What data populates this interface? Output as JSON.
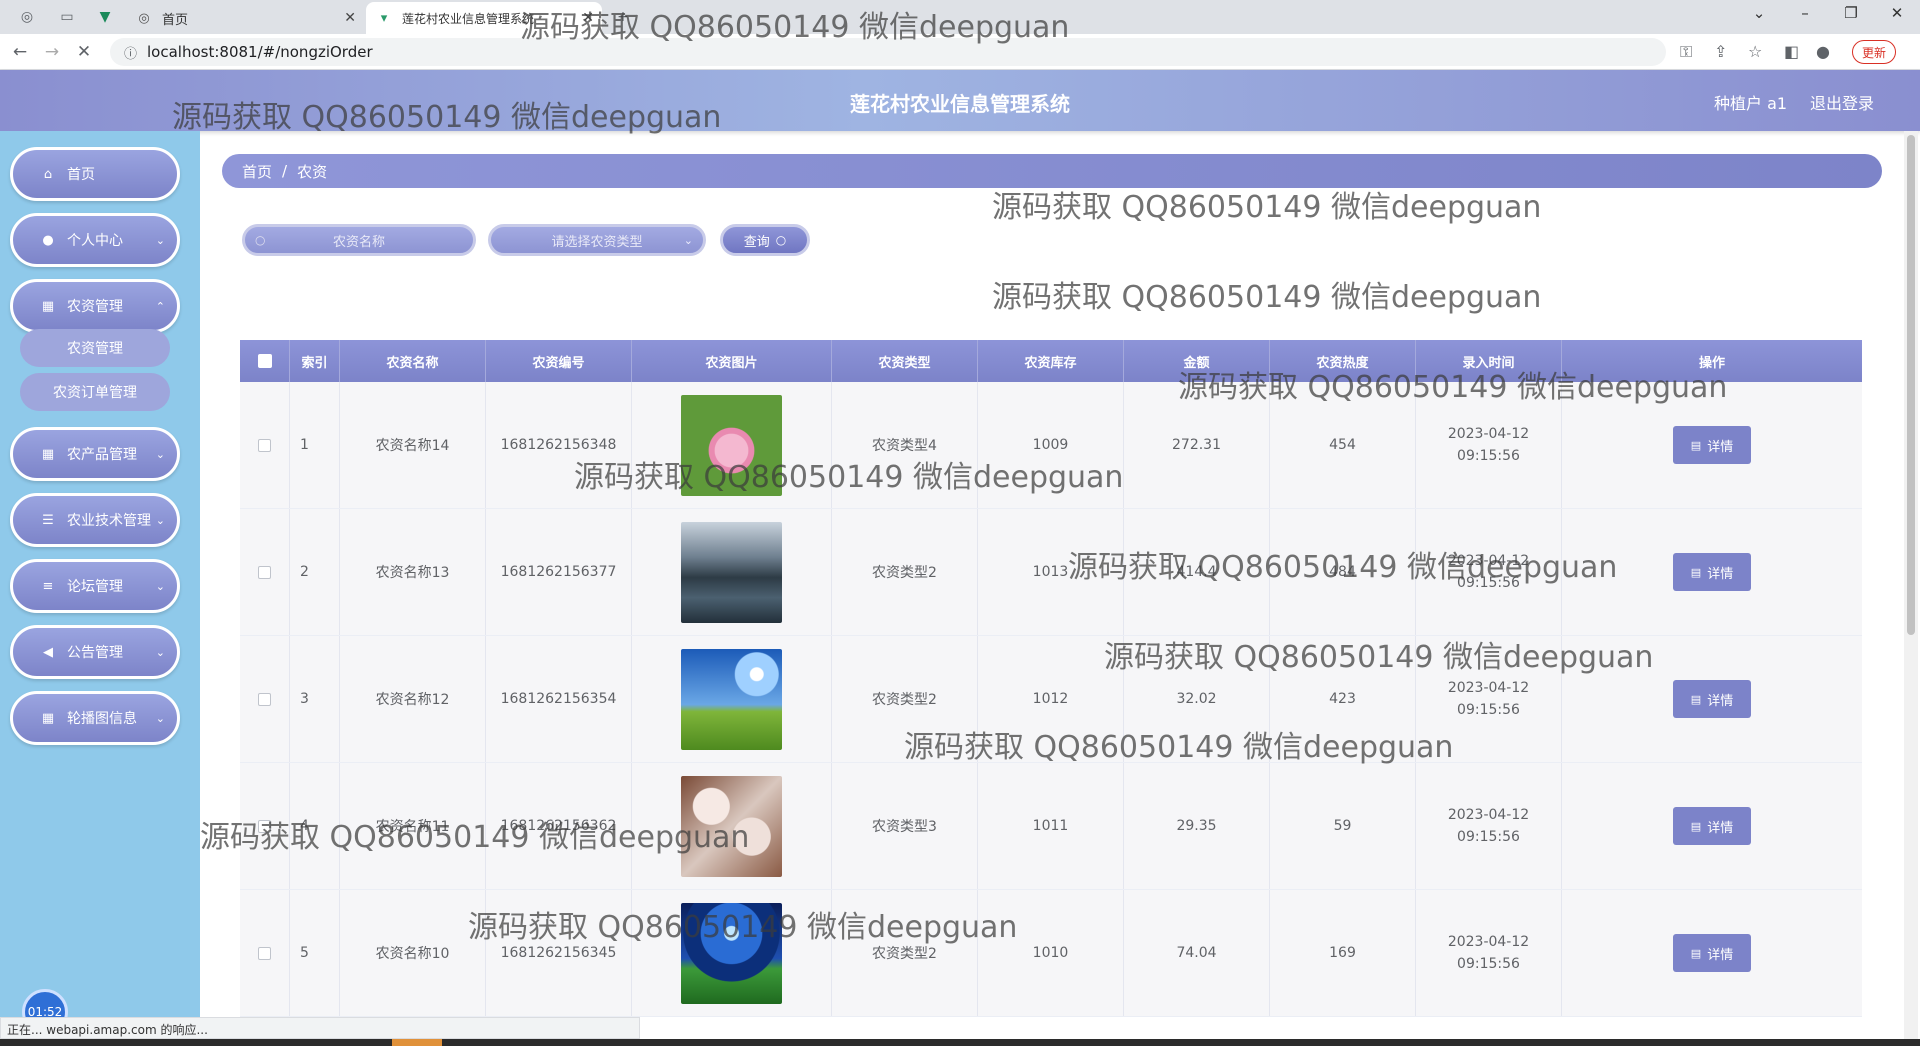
{
  "browser": {
    "tabs": [
      {
        "label": "首页",
        "active": false
      },
      {
        "label": "莲花村农业信息管理系统",
        "active": true
      }
    ],
    "url": "localhost:8081/#/nongziOrder",
    "update_label": "更新",
    "status_text": "正在... webapi.amap.com 的响应..."
  },
  "header": {
    "title": "莲花村农业信息管理系统",
    "user": "种植户 a1",
    "logout": "退出登录"
  },
  "sidebar": {
    "items": [
      {
        "label": "首页",
        "icon": "home-icon"
      },
      {
        "label": "个人中心",
        "icon": "user-icon"
      },
      {
        "label": "农资管理",
        "icon": "grid-icon"
      },
      {
        "label": "农产品管理",
        "icon": "grid-icon"
      },
      {
        "label": "农业技术管理",
        "icon": "sliders-icon"
      },
      {
        "label": "论坛管理",
        "icon": "list-icon"
      },
      {
        "label": "公告管理",
        "icon": "megaphone-icon"
      },
      {
        "label": "轮播图信息",
        "icon": "grid-icon"
      }
    ],
    "submenu": [
      "农资管理",
      "农资订单管理"
    ],
    "clock": "01:52"
  },
  "breadcrumb": {
    "home": "首页",
    "sep": "/",
    "current": "农资"
  },
  "search": {
    "name_placeholder": "农资名称",
    "type_placeholder": "请选择农资类型",
    "query_label": "查询"
  },
  "table": {
    "columns": [
      "索引",
      "农资名称",
      "农资编号",
      "农资图片",
      "农资类型",
      "农资库存",
      "金额",
      "农资热度",
      "录入时间",
      "操作"
    ],
    "detail_label": "详情",
    "rows": [
      {
        "index": "1",
        "name": "农资名称14",
        "code": "1681262156348",
        "image": "lotus-flower-photo",
        "type": "农资类型4",
        "stock": "1009",
        "amount": "272.31",
        "heat": "454",
        "time": "2023-04-12 09:15:56"
      },
      {
        "index": "2",
        "name": "农资名称13",
        "code": "1681262156377",
        "image": "lake-village-photo",
        "type": "农资类型2",
        "stock": "1013",
        "amount": "414.4",
        "heat": "484",
        "time": "2023-04-12 09:15:56"
      },
      {
        "index": "3",
        "name": "农资名称12",
        "code": "1681262156354",
        "image": "sunny-meadow-photo",
        "type": "农资类型2",
        "stock": "1012",
        "amount": "32.02",
        "heat": "423",
        "time": "2023-04-12 09:15:56"
      },
      {
        "index": "4",
        "name": "农资名称11",
        "code": "1681262156362",
        "image": "blossom-branch-photo",
        "type": "农资类型3",
        "stock": "1011",
        "amount": "29.35",
        "heat": "59",
        "time": "2023-04-12 09:15:56"
      },
      {
        "index": "5",
        "name": "农资名称10",
        "code": "1681262156345",
        "image": "night-field-photo",
        "type": "农资类型2",
        "stock": "1010",
        "amount": "74.04",
        "heat": "169",
        "time": "2023-04-12 09:15:56"
      }
    ]
  },
  "watermark": "源码获取 QQ86050149 微信deepguan",
  "colors": {
    "accent": "#7c83c9",
    "sidebar": "#8fc9ea",
    "header": "#8a8fd0"
  }
}
